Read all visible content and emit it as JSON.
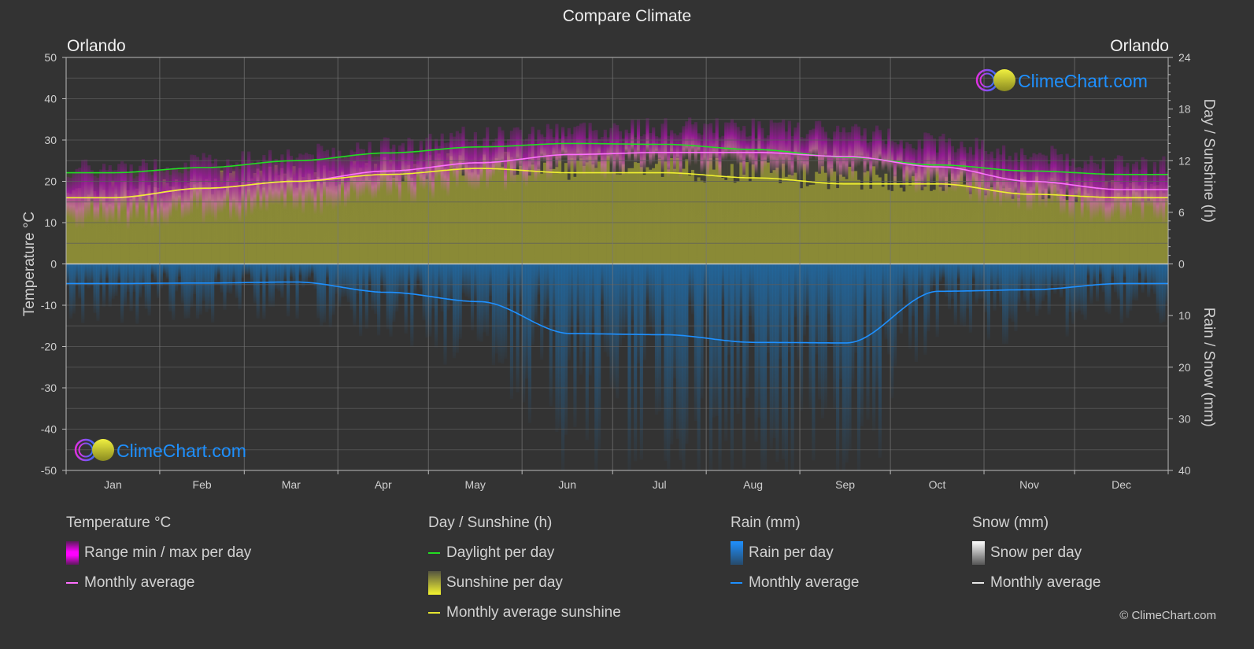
{
  "header": {
    "title": "Compare Climate",
    "city_left": "Orlando",
    "city_right": "Orlando"
  },
  "watermark": {
    "text": "ClimeChart.com"
  },
  "copyright": "© ClimeChart.com",
  "colors": {
    "background": "#333333",
    "grid": "#5c5c5c",
    "temp_range": "#c020c0",
    "temp_avg": "#ff70ff",
    "daylight": "#22dd22",
    "sunshine_fill": "#8c8c35",
    "sunshine_avg": "#f0f030",
    "rain_fill": "#1f6fae",
    "rain_avg": "#1e90ff",
    "snow_avg": "#ffffff",
    "logo_text": "#1e90ff"
  },
  "legend": {
    "groups": [
      {
        "heading": "Temperature °C",
        "items": [
          {
            "type": "box",
            "label": "Range min / max per day",
            "icon": "magenta-gradient-swatch"
          },
          {
            "type": "line",
            "label": "Monthly average",
            "icon": "pink-line-swatch"
          }
        ]
      },
      {
        "heading": "Day / Sunshine (h)",
        "items": [
          {
            "type": "line",
            "label": "Daylight per day",
            "icon": "green-line-swatch"
          },
          {
            "type": "box",
            "label": "Sunshine per day",
            "icon": "yellow-gradient-swatch"
          },
          {
            "type": "line",
            "label": "Monthly average sunshine",
            "icon": "yellow-line-swatch"
          }
        ]
      },
      {
        "heading": "Rain (mm)",
        "items": [
          {
            "type": "box",
            "label": "Rain per day",
            "icon": "blue-gradient-swatch"
          },
          {
            "type": "line",
            "label": "Monthly average",
            "icon": "blue-line-swatch"
          }
        ]
      },
      {
        "heading": "Snow (mm)",
        "items": [
          {
            "type": "box",
            "label": "Snow per day",
            "icon": "white-gradient-swatch"
          },
          {
            "type": "line",
            "label": "Monthly average",
            "icon": "white-line-swatch"
          }
        ]
      }
    ]
  },
  "chart_data": {
    "type": "line",
    "title": "Compare Climate",
    "categories": [
      "Jan",
      "Feb",
      "Mar",
      "Apr",
      "May",
      "Jun",
      "Jul",
      "Aug",
      "Sep",
      "Oct",
      "Nov",
      "Dec"
    ],
    "left_axis": {
      "label": "Temperature °C",
      "range": [
        -50,
        50
      ],
      "ticks": [
        50,
        40,
        30,
        20,
        10,
        0,
        -10,
        -20,
        -30,
        -40,
        -50
      ]
    },
    "right_axis_top": {
      "label": "Day / Sunshine (h)",
      "range": [
        0,
        24
      ],
      "ticks": [
        24,
        18,
        12,
        6,
        0
      ]
    },
    "right_axis_bottom": {
      "label": "Rain / Snow (mm)",
      "range": [
        0,
        40
      ],
      "ticks": [
        0,
        10,
        20,
        30,
        40
      ],
      "inverted": true
    },
    "grid": true,
    "legend_position": "bottom",
    "series": [
      {
        "name": "Temperature range min per day (°C)",
        "axis": "left",
        "kind": "band-min",
        "values": [
          11,
          12,
          14,
          17,
          20,
          23,
          23.5,
          23.5,
          23,
          19,
          15,
          12
        ]
      },
      {
        "name": "Temperature range max per day (°C)",
        "axis": "left",
        "kind": "band-max",
        "values": [
          23,
          24.5,
          26.5,
          28.5,
          31,
          32.5,
          33,
          33,
          32,
          29.5,
          26.5,
          24
        ]
      },
      {
        "name": "Temperature monthly average (°C)",
        "axis": "left",
        "kind": "line",
        "values": [
          16,
          18.3,
          20,
          22.5,
          24.5,
          26.5,
          27,
          27,
          26,
          23.5,
          20,
          18
        ]
      },
      {
        "name": "Daylight per day (h)",
        "axis": "right_top",
        "kind": "line",
        "values": [
          10.6,
          11.2,
          12.0,
          12.9,
          13.6,
          14.0,
          13.9,
          13.3,
          12.4,
          11.5,
          10.8,
          10.4
        ]
      },
      {
        "name": "Monthly average sunshine (h)",
        "axis": "right_top",
        "kind": "line",
        "values": [
          7.7,
          8.8,
          9.6,
          10.4,
          11.1,
          10.6,
          10.6,
          10.0,
          9.3,
          9.3,
          8.1,
          7.7
        ]
      },
      {
        "name": "Rain monthly average (mm)",
        "axis": "right_bottom",
        "kind": "line",
        "values": [
          3.8,
          3.7,
          3.5,
          5.5,
          7.3,
          13.5,
          13.7,
          15.2,
          15.3,
          5.3,
          5.0,
          3.8
        ]
      },
      {
        "name": "Snow monthly average (mm)",
        "axis": "right_bottom",
        "kind": "line",
        "values": [
          0,
          0,
          0,
          0,
          0,
          0,
          0,
          0,
          0,
          0,
          0,
          0
        ]
      }
    ]
  }
}
